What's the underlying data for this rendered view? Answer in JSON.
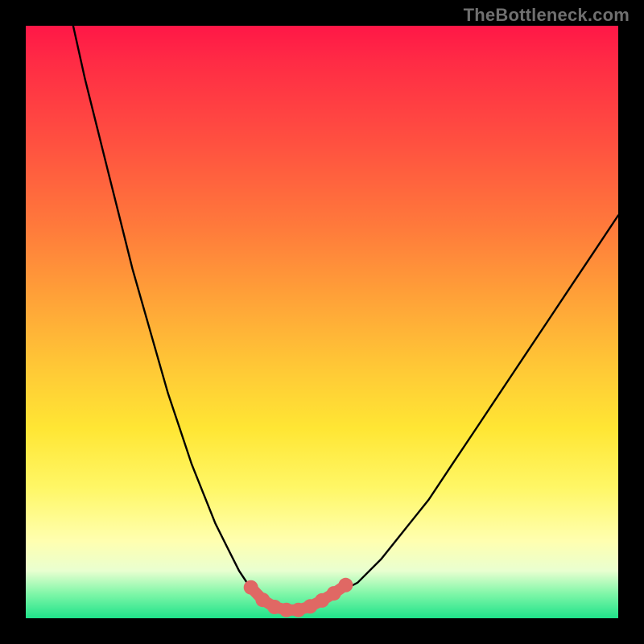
{
  "watermark": "TheBottleneck.com",
  "chart_data": {
    "type": "line",
    "title": "",
    "xlabel": "",
    "ylabel": "",
    "xlim": [
      0,
      100
    ],
    "ylim": [
      0,
      100
    ],
    "grid": false,
    "series": [
      {
        "name": "bottleneck-curve",
        "x": [
          8,
          10,
          12,
          14,
          16,
          18,
          20,
          22,
          24,
          26,
          28,
          30,
          32,
          34,
          36,
          38,
          40,
          42,
          44,
          46,
          48,
          56,
          60,
          64,
          68,
          72,
          76,
          80,
          84,
          88,
          92,
          96,
          100
        ],
        "y": [
          100,
          91,
          83,
          75,
          67,
          59,
          52,
          45,
          38,
          32,
          26,
          21,
          16,
          12,
          8,
          5,
          3,
          1.7,
          1.2,
          1.2,
          1.8,
          6,
          10,
          15,
          20,
          26,
          32,
          38,
          44,
          50,
          56,
          62,
          68
        ]
      }
    ],
    "highlight": {
      "name": "valley-dots",
      "color": "#e06864",
      "points_x": [
        38,
        40,
        42,
        44,
        46,
        48,
        50,
        52,
        54
      ],
      "points_y": [
        5.2,
        3.1,
        1.9,
        1.4,
        1.4,
        2.0,
        3.0,
        4.2,
        5.6
      ]
    },
    "gradient_stops": [
      {
        "pos": 0,
        "color": "#ff1747"
      },
      {
        "pos": 20,
        "color": "#ff5140"
      },
      {
        "pos": 46,
        "color": "#ffa238"
      },
      {
        "pos": 68,
        "color": "#ffe634"
      },
      {
        "pos": 87,
        "color": "#ffffb0"
      },
      {
        "pos": 96,
        "color": "#7cf6a7"
      },
      {
        "pos": 100,
        "color": "#1fe28a"
      }
    ]
  }
}
